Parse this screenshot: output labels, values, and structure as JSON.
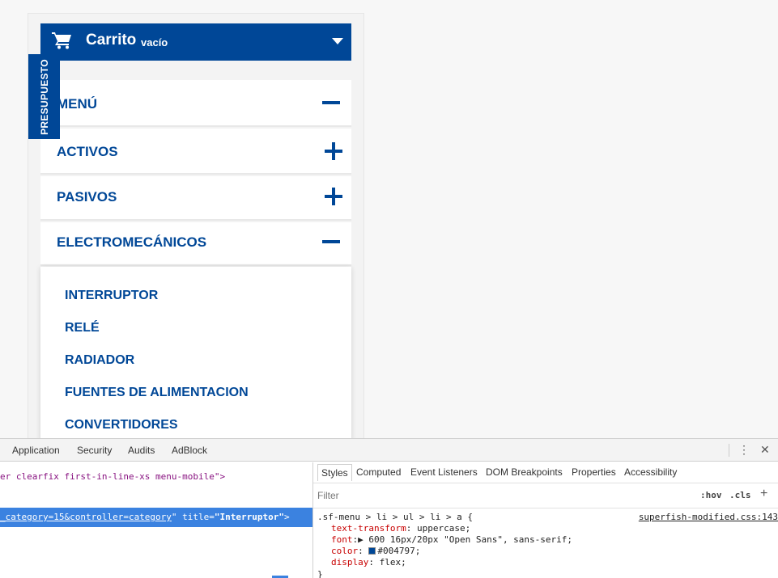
{
  "cart": {
    "title": "Carrito",
    "status": "vacío",
    "icon": "shopping-cart-icon"
  },
  "badge": {
    "label": "PRESUPUESTO"
  },
  "menu": [
    {
      "label": "MENÚ",
      "state": "expanded"
    },
    {
      "label": "ACTIVOS",
      "state": "collapsed"
    },
    {
      "label": "PASIVOS",
      "state": "collapsed"
    },
    {
      "label": "ELECTROMECÁNICOS",
      "state": "expanded"
    }
  ],
  "submenu": [
    "INTERRUPTOR",
    "RELÉ",
    "RADIADOR",
    "FUENTES DE ALIMENTACION",
    "CONVERTIDORES"
  ],
  "devtools": {
    "tabs": [
      "Application",
      "Security",
      "Audits",
      "AdBlock"
    ],
    "elements": {
      "line1_fragment": "er clearfix first-in-line-xs menu-mobile",
      "line1_end": "\">",
      "selected_fragment": "_category=15&controller=category",
      "selected_attr": "\" title=",
      "selected_value": "\"Interruptor\"",
      "selected_end": ">"
    },
    "styles": {
      "tabs": [
        "Styles",
        "Computed",
        "Event Listeners",
        "DOM Breakpoints",
        "Properties",
        "Accessibility"
      ],
      "filter_placeholder": "Filter",
      "hov": ":hov",
      "cls": ".cls",
      "selector": ".sf-menu > li > ul > li > a {",
      "source": "superfish-modified.css:143",
      "props": [
        {
          "name": "text-transform",
          "value": "uppercase;"
        },
        {
          "name": "font",
          "value": "600 16px/20px \"Open Sans\", sans-serif;"
        },
        {
          "name": "color",
          "value": "#004797;"
        },
        {
          "name": "display",
          "value": "flex;"
        }
      ],
      "close_brace": "}"
    }
  },
  "colors": {
    "brand": "#004797",
    "devtools_selection": "#3b82e0"
  }
}
